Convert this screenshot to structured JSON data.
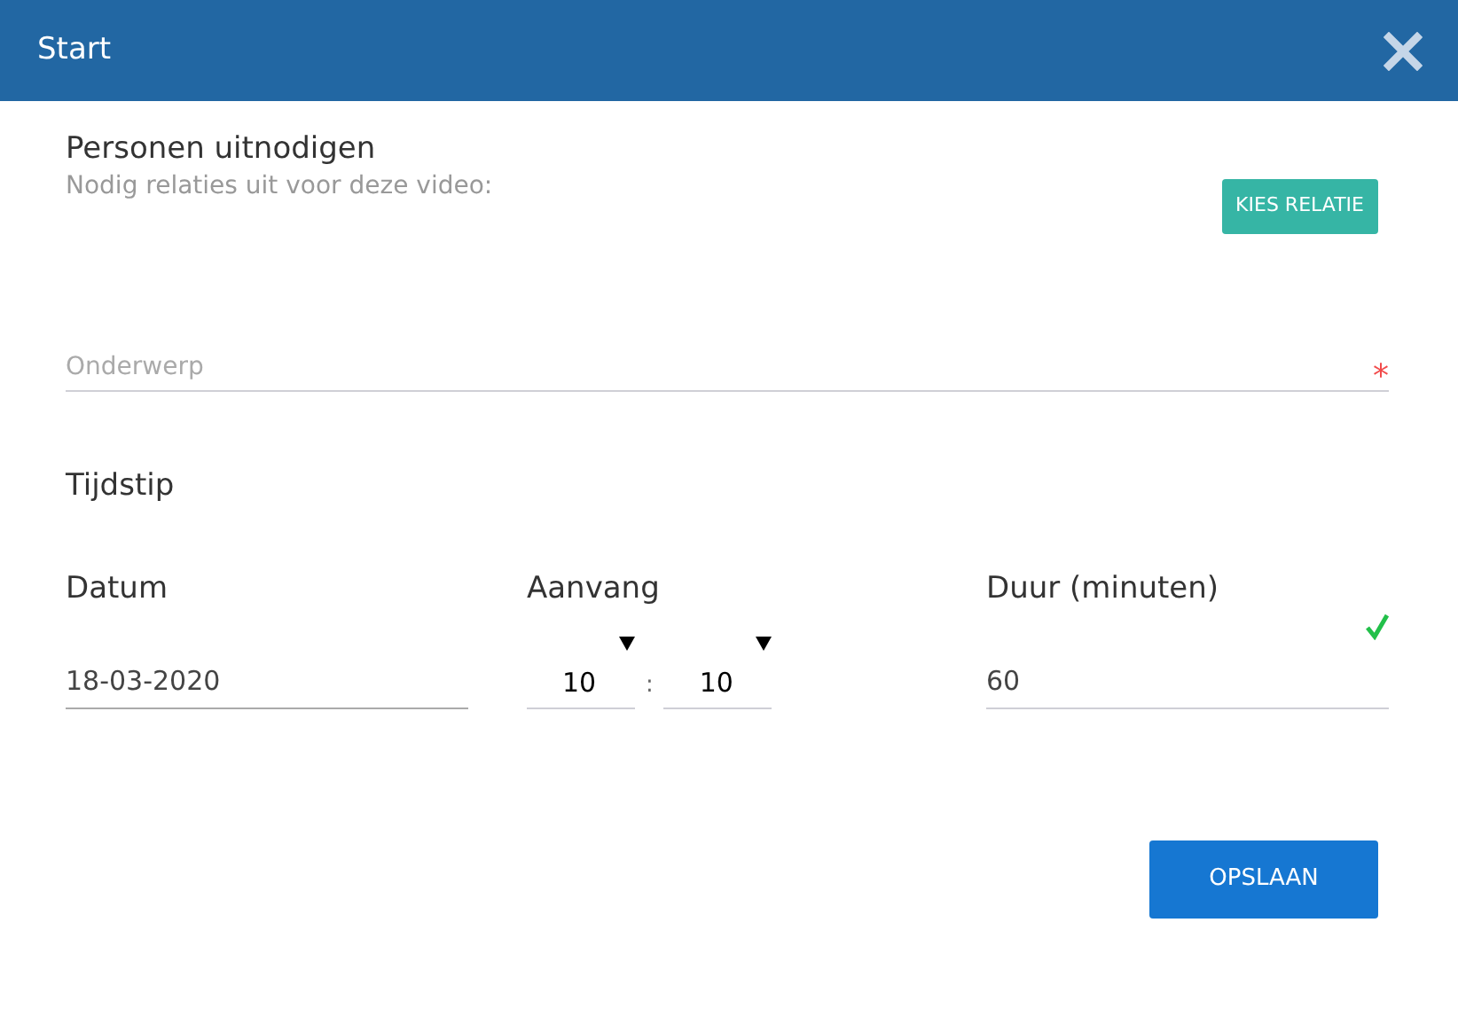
{
  "window": {
    "title": "Start"
  },
  "invite": {
    "heading": "Personen uitnodigen",
    "subtitle": "Nodig relaties uit voor deze video:",
    "button": "KIES RELATIE"
  },
  "subject": {
    "placeholder": "Onderwerp",
    "required_mark": "*"
  },
  "time": {
    "heading": "Tijdstip",
    "date": {
      "label": "Datum",
      "value": "18-03-2020"
    },
    "start": {
      "label": "Aanvang",
      "hour": "10",
      "minute": "10",
      "separator": ":"
    },
    "duration": {
      "label": "Duur (minuten)",
      "value": "60",
      "valid": true
    }
  },
  "buttons": {
    "save": "OPSLAAN"
  }
}
